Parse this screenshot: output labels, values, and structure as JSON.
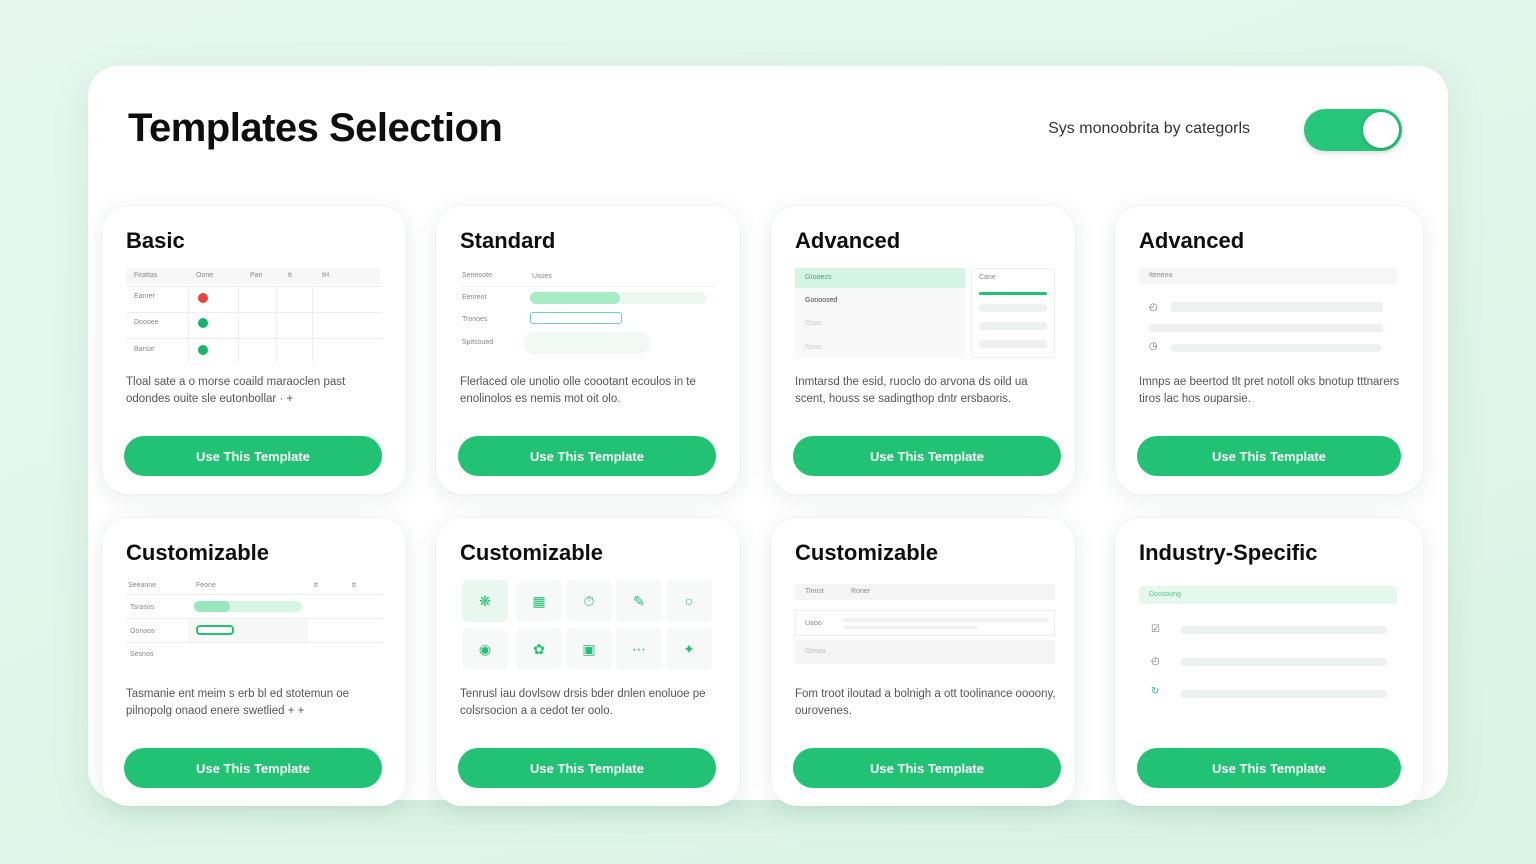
{
  "page": {
    "title": "Templates Selection",
    "toggle_label": "Sys monoobrita by categorls",
    "toggle_on": true
  },
  "colors": {
    "accent": "#22c274",
    "accent_light": "#c9f1da",
    "danger": "#e8453c"
  },
  "cards": [
    {
      "title": "Basic",
      "desc": "Tloal sate a o morse coaild maraoclen past odondes ouite sle eutonbollar · +",
      "button": "Use This Template",
      "preview": {
        "headers": [
          "Feattas",
          "Oone",
          "Pan",
          "tt",
          "tH"
        ],
        "rows": [
          "Eanrer",
          "Doooee",
          "Barsor"
        ]
      }
    },
    {
      "title": "Standard",
      "desc": "Flerlaced ole unolio olle coootant ecoulos in te enolinolos es nemis mot oit olo.",
      "button": "Use This Template",
      "preview": {
        "headers": [
          "Seneoote",
          "Uases"
        ],
        "rows": [
          "Eenrent",
          "Tronoes",
          "Spitsoued"
        ]
      }
    },
    {
      "title": "Advanced",
      "desc": "Inmtarsd the esid, ruoclo do arvona ds oild ua scent, houss se sadingthop dntr ersbaoris.",
      "button": "Use This Template",
      "preview": {
        "headers": [
          "Grooecs",
          "Cane"
        ],
        "rows": [
          "Gonoosed",
          "Osos",
          "Noos"
        ]
      }
    },
    {
      "title": "Advanced",
      "desc": "Imnps ae beertod tlt pret notoll oks bnotup tttnarers tiros lac hos ouparsie.",
      "button": "Use This Template",
      "preview": {
        "headers": [
          "Iteneno"
        ],
        "rows": []
      }
    },
    {
      "title": "Customizable",
      "desc": "Tasmanie ent meim s erb bl ed stotemun oe pilnopolg onaod enere swetlied + +",
      "button": "Use This Template",
      "preview": {
        "headers": [
          "Seeanne",
          "Feone",
          "tt",
          "tt"
        ],
        "rows": [
          "Tsrasos",
          "Oonoos",
          "Sesnos"
        ]
      }
    },
    {
      "title": "Customizable",
      "desc": "Tenrusl iau dovlsow drsis bder dnlen enoluoe pe colsrsocion a a cedot ter oolo.",
      "button": "Use This Template",
      "preview": {
        "icons": [
          "sparkle-icon",
          "document-icon",
          "timer-icon",
          "edit-icon",
          "circle-icon",
          "badge-icon",
          "leaf-icon",
          "book-icon",
          "dots-icon",
          "star-icon"
        ]
      }
    },
    {
      "title": "Customizable",
      "desc": "Fom troot iloutad a bolnigh a ott toolinance oooony, ourovenes.",
      "button": "Use This Template",
      "preview": {
        "headers": [
          "Tinnst",
          "Roner"
        ],
        "rows": [
          "Uaoo",
          "Ooseo"
        ]
      }
    },
    {
      "title": "Industry-Specific",
      "desc": "",
      "button": "Use This Template",
      "preview": {
        "headers": [
          "Doosoung"
        ],
        "rows": []
      }
    }
  ]
}
